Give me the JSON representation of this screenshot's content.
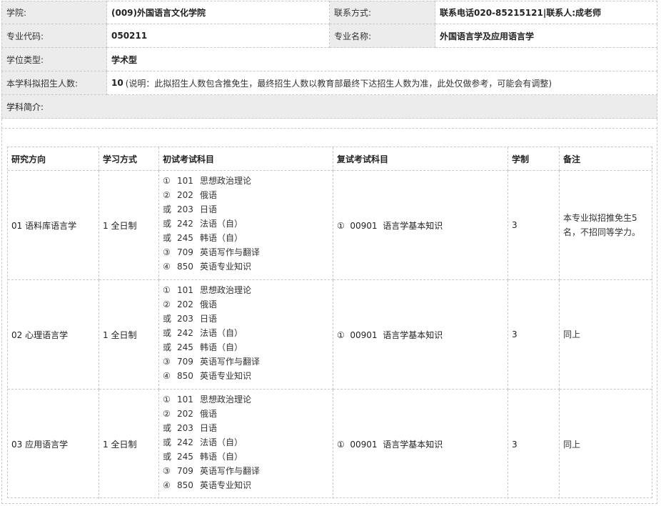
{
  "info": {
    "college_label": "学院:",
    "college_value": "(009)外国语言文化学院",
    "contact_label": "联系方式:",
    "contact_value": "联系电话020-85215121|联系人:成老师",
    "major_code_label": "专业代码:",
    "major_code_value": "050211",
    "major_name_label": "专业名称:",
    "major_name_value": "外国语言学及应用语言学",
    "degree_label": "学位类型:",
    "degree_value": "学术型",
    "enroll_label": "本学科拟招生人数:",
    "enroll_value": "10",
    "enroll_note": "(说明：此拟招生人数包含推免生，最终招生人数以教育部最终下达招生人数为准，此处仅做参考，可能会有调整)",
    "intro_label": "学科简介:"
  },
  "table": {
    "headers": [
      "研究方向",
      "学习方式",
      "初试考试科目",
      "复试考试科目",
      "学制",
      "备注"
    ],
    "rows": [
      {
        "direction": "01 语料库语言学",
        "mode": "1 全日制",
        "exams": [
          {
            "mark": "①",
            "code": "101",
            "name": "思想政治理论"
          },
          {
            "mark": "②",
            "code": "202",
            "name": "俄语"
          },
          {
            "mark": "或",
            "code": "203",
            "name": "日语"
          },
          {
            "mark": "或",
            "code": "242",
            "name": "法语（自）"
          },
          {
            "mark": "或",
            "code": "245",
            "name": "韩语（自）"
          },
          {
            "mark": "③",
            "code": "709",
            "name": "英语写作与翻译"
          },
          {
            "mark": "④",
            "code": "850",
            "name": "英语专业知识"
          }
        ],
        "retest": "①  00901  语言学基本知识",
        "years": "3",
        "remark": "本专业拟招推免生5名，不招同等学力。"
      },
      {
        "direction": "02 心理语言学",
        "mode": "1 全日制",
        "exams": [
          {
            "mark": "①",
            "code": "101",
            "name": "思想政治理论"
          },
          {
            "mark": "②",
            "code": "202",
            "name": "俄语"
          },
          {
            "mark": "或",
            "code": "203",
            "name": "日语"
          },
          {
            "mark": "或",
            "code": "242",
            "name": "法语（自）"
          },
          {
            "mark": "或",
            "code": "245",
            "name": "韩语（自）"
          },
          {
            "mark": "③",
            "code": "709",
            "name": "英语写作与翻译"
          },
          {
            "mark": "④",
            "code": "850",
            "name": "英语专业知识"
          }
        ],
        "retest": "①  00901  语言学基本知识",
        "years": "3",
        "remark": "同上"
      },
      {
        "direction": "03 应用语言学",
        "mode": "1 全日制",
        "exams": [
          {
            "mark": "①",
            "code": "101",
            "name": "思想政治理论"
          },
          {
            "mark": "②",
            "code": "202",
            "name": "俄语"
          },
          {
            "mark": "或",
            "code": "203",
            "name": "日语"
          },
          {
            "mark": "或",
            "code": "242",
            "name": "法语（自）"
          },
          {
            "mark": "或",
            "code": "245",
            "name": "韩语（自）"
          },
          {
            "mark": "③",
            "code": "709",
            "name": "英语写作与翻译"
          },
          {
            "mark": "④",
            "code": "850",
            "name": "英语专业知识"
          }
        ],
        "retest": "①  00901  语言学基本知识",
        "years": "3",
        "remark": "同上"
      }
    ]
  }
}
